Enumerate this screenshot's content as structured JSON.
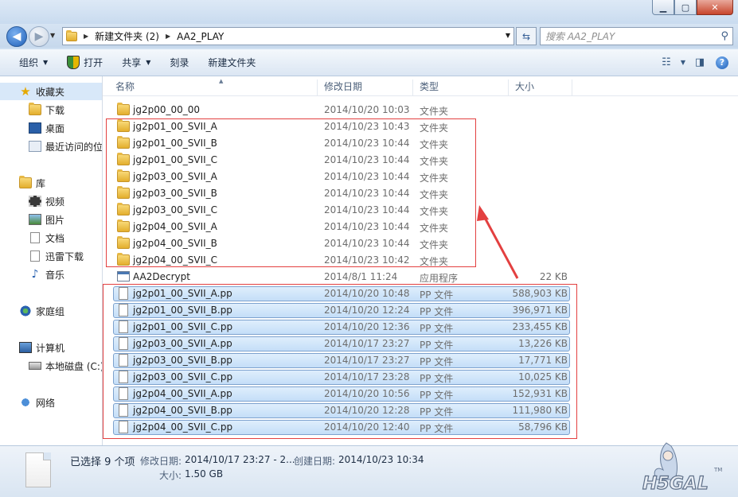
{
  "window": {
    "min_label": "▁",
    "max_label": "▢",
    "close_label": "✕"
  },
  "nav": {
    "breadcrumb": [
      "新建文件夹 (2)",
      "AA2_PLAY"
    ],
    "search_placeholder": "搜索 AA2_PLAY"
  },
  "toolbar": {
    "organize": "组织",
    "open": "打开",
    "share": "共享",
    "burn": "刻录",
    "new_folder": "新建文件夹"
  },
  "sidebar": {
    "favorites": "收藏夹",
    "downloads": "下载",
    "desktop": "桌面",
    "recent": "最近访问的位置",
    "libraries": "库",
    "videos": "视频",
    "pictures": "图片",
    "documents": "文档",
    "xunlei": "迅雷下载",
    "music": "音乐",
    "homegroup": "家庭组",
    "computer": "计算机",
    "local_disk": "本地磁盘 (C:)",
    "network": "网络"
  },
  "columns": {
    "name": "名称",
    "date": "修改日期",
    "type": "类型",
    "size": "大小"
  },
  "files": [
    {
      "name": "jg2p00_00_00",
      "date": "2014/10/20 10:03",
      "type": "文件夹",
      "size": "",
      "kind": "folder",
      "selected": false
    },
    {
      "name": "jg2p01_00_SVII_A",
      "date": "2014/10/23 10:43",
      "type": "文件夹",
      "size": "",
      "kind": "folder",
      "selected": false
    },
    {
      "name": "jg2p01_00_SVII_B",
      "date": "2014/10/23 10:44",
      "type": "文件夹",
      "size": "",
      "kind": "folder",
      "selected": false
    },
    {
      "name": "jg2p01_00_SVII_C",
      "date": "2014/10/23 10:44",
      "type": "文件夹",
      "size": "",
      "kind": "folder",
      "selected": false
    },
    {
      "name": "jg2p03_00_SVII_A",
      "date": "2014/10/23 10:44",
      "type": "文件夹",
      "size": "",
      "kind": "folder",
      "selected": false
    },
    {
      "name": "jg2p03_00_SVII_B",
      "date": "2014/10/23 10:44",
      "type": "文件夹",
      "size": "",
      "kind": "folder",
      "selected": false
    },
    {
      "name": "jg2p03_00_SVII_C",
      "date": "2014/10/23 10:44",
      "type": "文件夹",
      "size": "",
      "kind": "folder",
      "selected": false
    },
    {
      "name": "jg2p04_00_SVII_A",
      "date": "2014/10/23 10:44",
      "type": "文件夹",
      "size": "",
      "kind": "folder",
      "selected": false
    },
    {
      "name": "jg2p04_00_SVII_B",
      "date": "2014/10/23 10:44",
      "type": "文件夹",
      "size": "",
      "kind": "folder",
      "selected": false
    },
    {
      "name": "jg2p04_00_SVII_C",
      "date": "2014/10/23 10:42",
      "type": "文件夹",
      "size": "",
      "kind": "folder",
      "selected": false
    },
    {
      "name": "AA2Decrypt",
      "date": "2014/8/1 11:24",
      "type": "应用程序",
      "size": "22 KB",
      "kind": "exe",
      "selected": false
    },
    {
      "name": "jg2p01_00_SVII_A.pp",
      "date": "2014/10/20 10:48",
      "type": "PP 文件",
      "size": "588,903 KB",
      "kind": "file",
      "selected": true
    },
    {
      "name": "jg2p01_00_SVII_B.pp",
      "date": "2014/10/20 12:24",
      "type": "PP 文件",
      "size": "396,971 KB",
      "kind": "file",
      "selected": true
    },
    {
      "name": "jg2p01_00_SVII_C.pp",
      "date": "2014/10/20 12:36",
      "type": "PP 文件",
      "size": "233,455 KB",
      "kind": "file",
      "selected": true
    },
    {
      "name": "jg2p03_00_SVII_A.pp",
      "date": "2014/10/17 23:27",
      "type": "PP 文件",
      "size": "13,226 KB",
      "kind": "file",
      "selected": true
    },
    {
      "name": "jg2p03_00_SVII_B.pp",
      "date": "2014/10/17 23:27",
      "type": "PP 文件",
      "size": "17,771 KB",
      "kind": "file",
      "selected": true
    },
    {
      "name": "jg2p03_00_SVII_C.pp",
      "date": "2014/10/17 23:28",
      "type": "PP 文件",
      "size": "10,025 KB",
      "kind": "file",
      "selected": true
    },
    {
      "name": "jg2p04_00_SVII_A.pp",
      "date": "2014/10/20 10:56",
      "type": "PP 文件",
      "size": "152,931 KB",
      "kind": "file",
      "selected": true
    },
    {
      "name": "jg2p04_00_SVII_B.pp",
      "date": "2014/10/20 12:28",
      "type": "PP 文件",
      "size": "111,980 KB",
      "kind": "file",
      "selected": true
    },
    {
      "name": "jg2p04_00_SVII_C.pp",
      "date": "2014/10/20 12:40",
      "type": "PP 文件",
      "size": "58,796 KB",
      "kind": "file",
      "selected": true
    }
  ],
  "status": {
    "selected": "已选择 9 个项",
    "modified_label": "修改日期:",
    "modified_value": "2014/10/17 23:27 - 2...",
    "created_label": "创建日期:",
    "created_value": "2014/10/23 10:34",
    "size_label": "大小:",
    "size_value": "1.50 GB"
  },
  "watermark": {
    "logo_text": "H5GAL",
    "tm": "TM"
  },
  "colors": {
    "annotation_red": "#e34040",
    "selection_blue": "#c4def8"
  }
}
